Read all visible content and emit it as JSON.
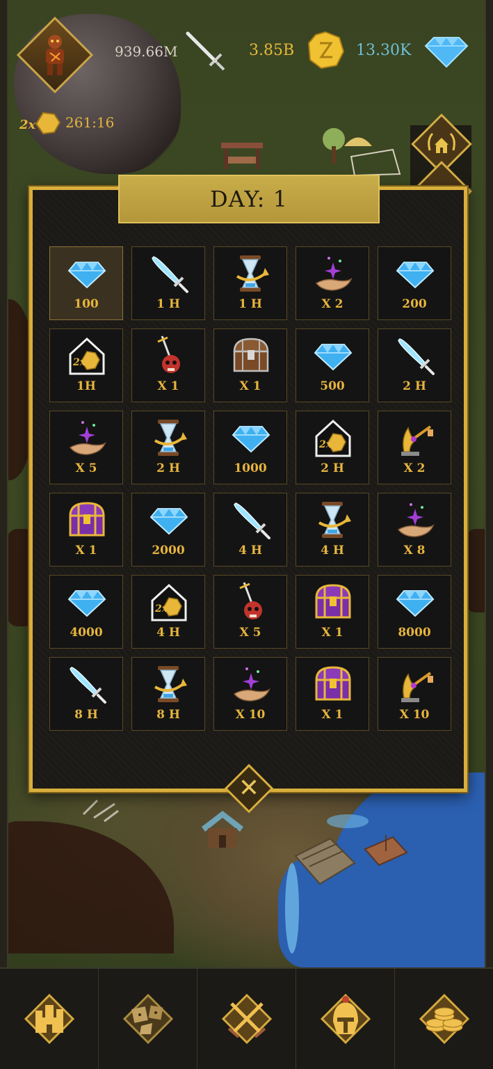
{
  "hud": {
    "power": "939.66M",
    "gold": "3.85B",
    "gems": "13.30K",
    "boost_timer": "261:16",
    "boost_badge": "2x",
    "colors": {
      "power": "#d8d2c4",
      "gold": "#e6b93a",
      "gems": "#6fc1d6"
    }
  },
  "dialog": {
    "title": "DAY: 1",
    "rewards": [
      {
        "icon": "gem-icon",
        "label": "100"
      },
      {
        "icon": "sword-icon",
        "label": "1 H"
      },
      {
        "icon": "hourglass-icon",
        "label": "1 H"
      },
      {
        "icon": "magic-hand-icon",
        "label": "X 2"
      },
      {
        "icon": "gem-icon",
        "label": "200"
      },
      {
        "icon": "gold-boost-house-icon",
        "label": "1H"
      },
      {
        "icon": "skull-sword-icon",
        "label": "X 1"
      },
      {
        "icon": "wooden-chest-icon",
        "label": "X 1"
      },
      {
        "icon": "gem-icon",
        "label": "500"
      },
      {
        "icon": "sword-icon",
        "label": "2 H"
      },
      {
        "icon": "magic-hand-icon",
        "label": "X 5"
      },
      {
        "icon": "hourglass-icon",
        "label": "2 H"
      },
      {
        "icon": "gem-icon",
        "label": "1000"
      },
      {
        "icon": "gold-boost-house-icon",
        "label": "2 H"
      },
      {
        "icon": "golden-key-icon",
        "label": "X 2"
      },
      {
        "icon": "purple-chest-icon",
        "label": "X 1"
      },
      {
        "icon": "gem-icon",
        "label": "2000"
      },
      {
        "icon": "sword-icon",
        "label": "4 H"
      },
      {
        "icon": "hourglass-icon",
        "label": "4 H"
      },
      {
        "icon": "magic-hand-icon",
        "label": "X 8"
      },
      {
        "icon": "gem-icon",
        "label": "4000"
      },
      {
        "icon": "gold-boost-house-icon",
        "label": "4 H"
      },
      {
        "icon": "skull-sword-icon",
        "label": "X 5"
      },
      {
        "icon": "purple-chest-icon",
        "label": "X 1"
      },
      {
        "icon": "gem-icon",
        "label": "8000"
      },
      {
        "icon": "sword-icon",
        "label": "8 H"
      },
      {
        "icon": "hourglass-icon",
        "label": "8 H"
      },
      {
        "icon": "magic-hand-icon",
        "label": "X 10"
      },
      {
        "icon": "purple-chest-icon",
        "label": "X 1"
      },
      {
        "icon": "golden-key-icon",
        "label": "X 10"
      }
    ],
    "close_icon": "close-icon"
  },
  "nav": [
    {
      "icon": "castle-icon"
    },
    {
      "icon": "dice-icon"
    },
    {
      "icon": "crossed-swords-icon"
    },
    {
      "icon": "helmet-icon"
    },
    {
      "icon": "coins-icon"
    }
  ],
  "colors": {
    "accent": "#d9ae3c",
    "gem": "#3fb0f0",
    "label": "#e7b53e"
  }
}
